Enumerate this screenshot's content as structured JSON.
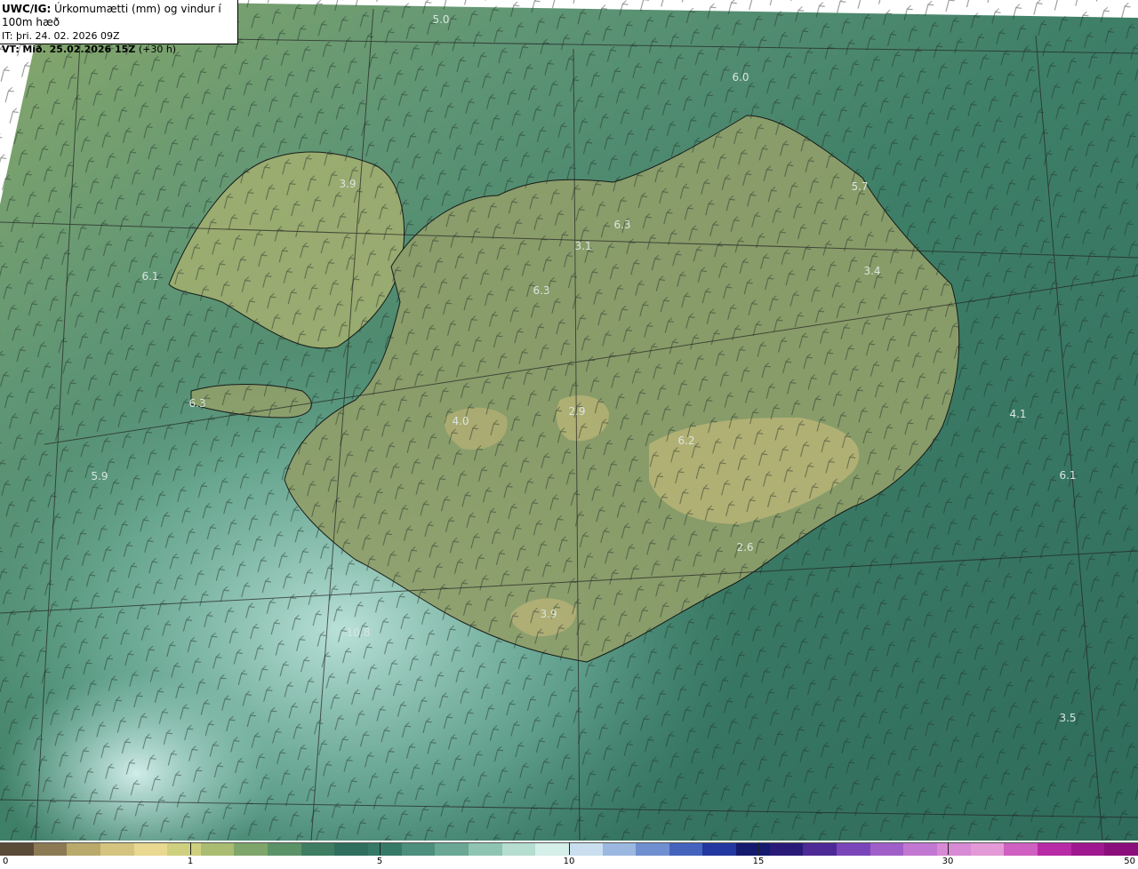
{
  "header": {
    "product": "UWC/IG:",
    "title": "Úrkomumætti (mm) og vindur í 100m hæð",
    "init_label": "IT:",
    "init_time": "þri. 24. 02. 2026 09Z",
    "valid_label": "VT:",
    "valid_time": "Mið. 25.02.2026 15Z",
    "lead": "(+30 h)"
  },
  "map_values": [
    "5.0",
    "6.0",
    "5.7",
    "3.9",
    "6.3",
    "3.1",
    "6.3",
    "3.4",
    "6.1",
    "6.3",
    "4.0",
    "2.9",
    "4.1",
    "6.2",
    "5.9",
    "6.1",
    "3.9",
    "10.8",
    "3.5",
    "2.6"
  ],
  "colorbar": {
    "ticks": [
      "0",
      "1",
      "5",
      "10",
      "15",
      "30",
      "50"
    ],
    "colors": [
      "#5a4a38",
      "#8c7a55",
      "#b9a96b",
      "#d4c480",
      "#e8d890",
      "#cfd07f",
      "#a9bc72",
      "#7fa66a",
      "#5c9268",
      "#3f7d62",
      "#2f6e5c",
      "#357a66",
      "#4c8f7c",
      "#6aa895",
      "#8fc4b3",
      "#b5ddd0",
      "#d5efe9",
      "#c9dfef",
      "#9cb8e0",
      "#6f8fd0",
      "#4463bd",
      "#2238a0",
      "#141a6e",
      "#2a1a78",
      "#4d2a95",
      "#7a45b8",
      "#a05ec8",
      "#c277d2",
      "#d88ad4",
      "#e49ad7",
      "#cf5fc0",
      "#b82aa6",
      "#a0188f",
      "#8a0f7c"
    ]
  }
}
